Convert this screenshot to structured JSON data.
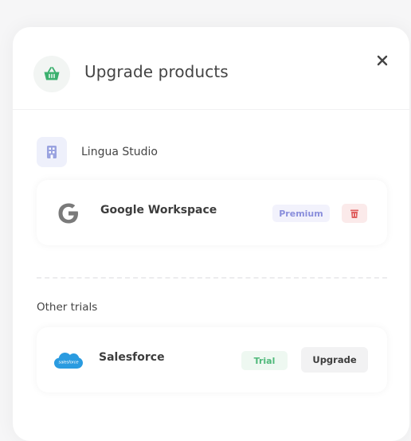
{
  "header": {
    "title": "Upgrade products"
  },
  "organization": {
    "name": "Lingua Studio"
  },
  "products": [
    {
      "name": "Google Workspace",
      "badge": "Premium"
    }
  ],
  "other_trials": {
    "label": "Other trials",
    "items": [
      {
        "name": "Salesforce",
        "badge": "Trial",
        "action_label": "Upgrade"
      }
    ]
  },
  "logos": {
    "salesforce_wordmark": "salesforce"
  },
  "colors": {
    "accent_green": "#4fb97a",
    "premium_purple": "#8a8fdc",
    "danger_red": "#e06060",
    "salesforce_blue": "#2a9be0"
  }
}
